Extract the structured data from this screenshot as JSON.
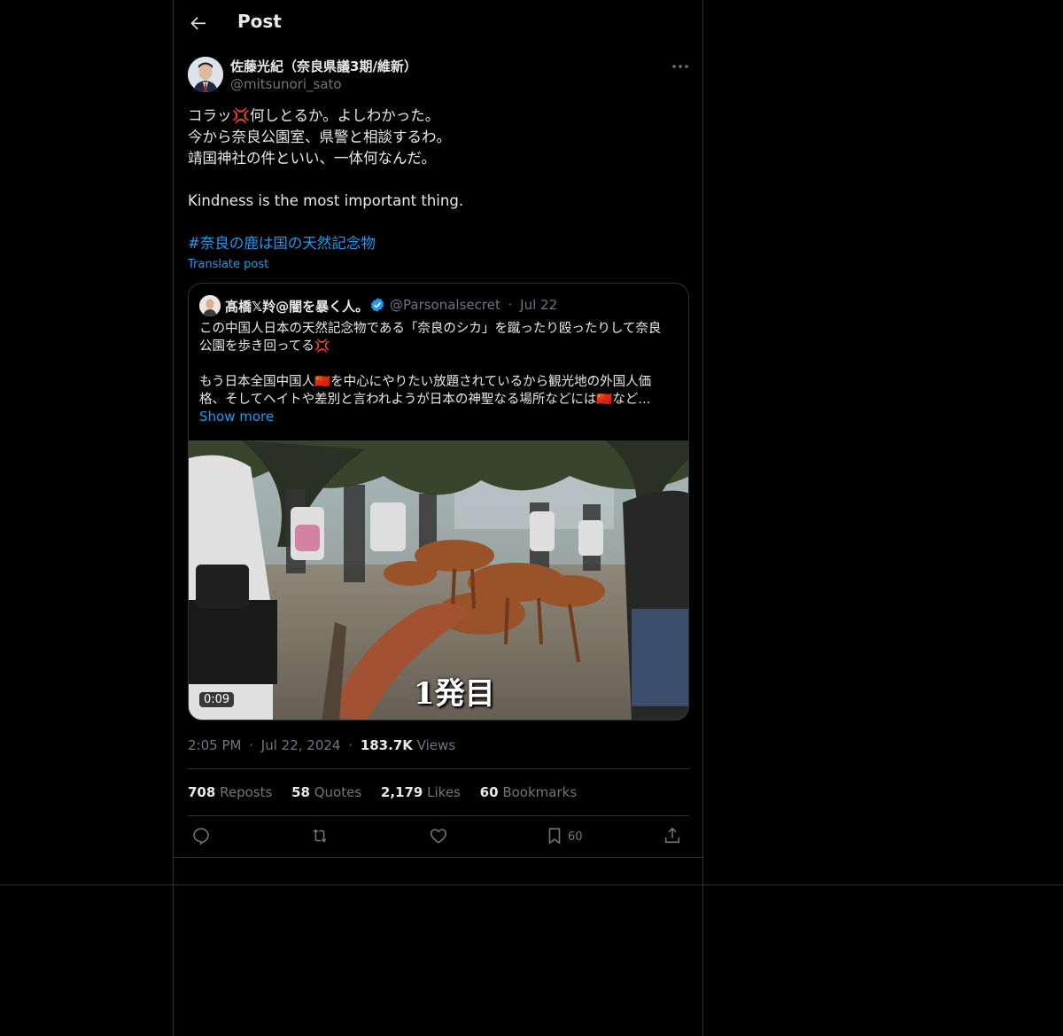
{
  "header": {
    "title": "Post",
    "back_icon": "arrow-left-icon"
  },
  "author": {
    "name": "佐藤光紀（奈良県議3期/維新）",
    "handle": "@mitsunori_sato"
  },
  "tweet": {
    "lines": [
      "コラッ💢何しとるか。よしわかった。",
      "今から奈良公園室、県警と相談するわ。",
      "靖国神社の件といい、一体何なんだ。"
    ],
    "english": "Kindness is the most important thing.",
    "hashtag": "#奈良の鹿は国の天然記念物",
    "translate": "Translate post"
  },
  "quote": {
    "name": "髙橋𝕏羚@闇を暴く人。",
    "handle": "@Parsonalsecret",
    "dot": "·",
    "date": "Jul 22",
    "lines": [
      "この中国人日本の天然記念物である「奈良のシカ」を蹴ったり殴ったりして奈良",
      "公園を歩き回ってる💢",
      "もう日本全国中国人🇨🇳を中心にやりたい放題されているから観光地の外国人価",
      "格、そしてヘイトや差別と言われようが日本の神聖なる場所などには🇨🇳など..."
    ],
    "show_more": "Show more",
    "video": {
      "duration": "0:09",
      "caption": "1発目"
    }
  },
  "meta": {
    "time": "2:05 PM",
    "dot": "·",
    "date": "Jul 22, 2024",
    "views_count": "183.7K",
    "views_label": "Views"
  },
  "stats": {
    "reposts": {
      "count": "708",
      "label": "Reposts"
    },
    "quotes": {
      "count": "58",
      "label": "Quotes"
    },
    "likes": {
      "count": "2,179",
      "label": "Likes"
    },
    "bookmarks": {
      "count": "60",
      "label": "Bookmarks"
    }
  },
  "actions": {
    "bookmark_count": "60"
  },
  "colors": {
    "background": "#000000",
    "text": "#e7e9ea",
    "muted": "#71767b",
    "accent": "#1d9bf0",
    "border": "#2f3336"
  }
}
